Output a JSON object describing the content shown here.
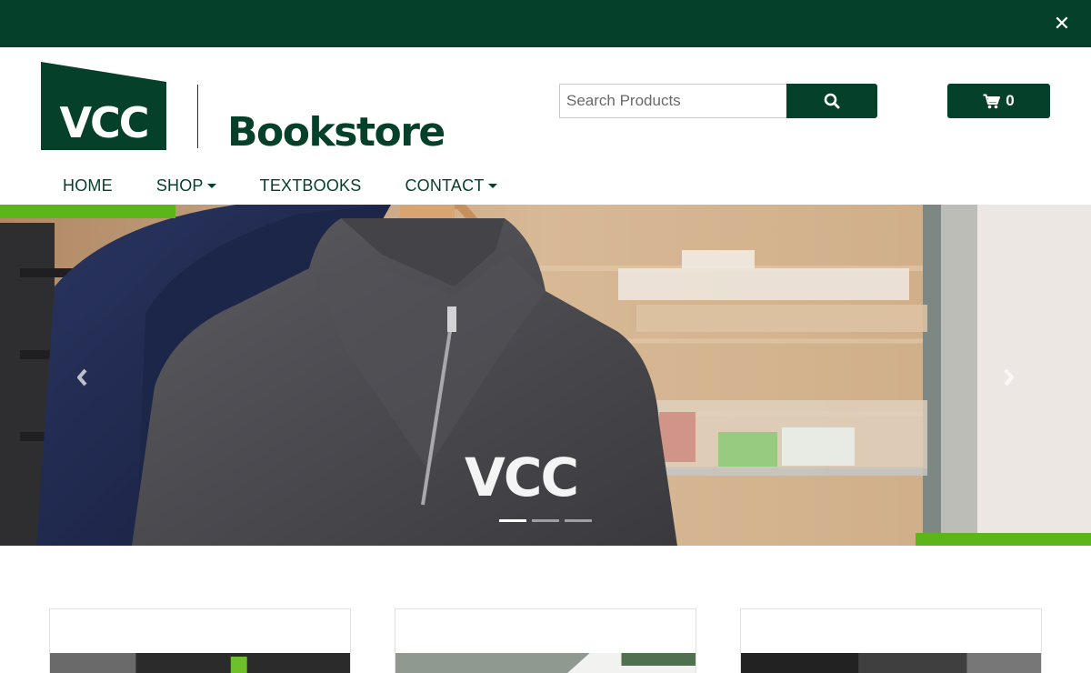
{
  "topbar": {
    "close_icon": "close-icon"
  },
  "brand": {
    "logo_text": "VCC",
    "word": "Bookstore"
  },
  "search": {
    "placeholder": "Search Products",
    "value": "",
    "button_icon": "search-icon"
  },
  "cart": {
    "icon": "cart-icon",
    "count": "0"
  },
  "nav": {
    "items": [
      {
        "label": "HOME",
        "dropdown": false
      },
      {
        "label": "SHOP",
        "dropdown": true
      },
      {
        "label": "TEXTBOOKS",
        "dropdown": false
      },
      {
        "label": "CONTACT",
        "dropdown": true
      }
    ]
  },
  "hero": {
    "shirt_print": "VCC",
    "slide_count": 3,
    "active_slide": 1,
    "prev_icon": "chevron-left-icon",
    "next_icon": "chevron-right-icon"
  },
  "colors": {
    "brand_green": "#05402a",
    "accent_green": "#5cb519"
  }
}
